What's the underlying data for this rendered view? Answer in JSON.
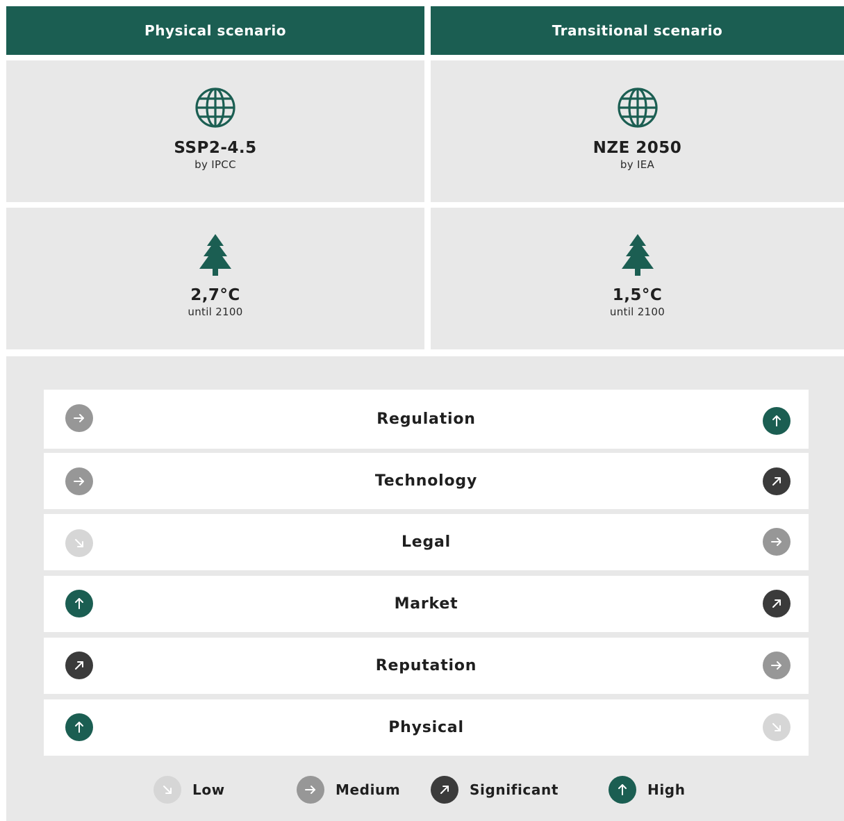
{
  "headers": {
    "physical": "Physical scenario",
    "transitional": "Transitional scenario"
  },
  "icons": {
    "scenario": "globe-icon",
    "temperature": "tree-icon"
  },
  "colors": {
    "header": "#1b5e52",
    "panel": "#e8e8e8",
    "low": "#d6d6d6",
    "medium": "#979797",
    "significant": "#3b3b3b",
    "high": "#1b5e52"
  },
  "physical": {
    "scenario_name": "SSP2-4.5",
    "scenario_source": "by IPCC",
    "temperature": "2,7°C",
    "temperature_period": "until 2100"
  },
  "transitional": {
    "scenario_name": "NZE 2050",
    "scenario_source": "by IEA",
    "temperature": "1,5°C",
    "temperature_period": "until 2100"
  },
  "risks": [
    {
      "label": "Regulation",
      "physical": "medium",
      "transitional": "high"
    },
    {
      "label": "Technology",
      "physical": "medium",
      "transitional": "significant"
    },
    {
      "label": "Legal",
      "physical": "low",
      "transitional": "medium"
    },
    {
      "label": "Market",
      "physical": "high",
      "transitional": "significant"
    },
    {
      "label": "Reputation",
      "physical": "significant",
      "transitional": "medium"
    },
    {
      "label": "Physical",
      "physical": "high",
      "transitional": "low"
    }
  ],
  "legend": [
    {
      "level": "low",
      "label": "Low"
    },
    {
      "level": "medium",
      "label": "Medium"
    },
    {
      "level": "significant",
      "label": "Significant"
    },
    {
      "level": "high",
      "label": "High"
    }
  ]
}
